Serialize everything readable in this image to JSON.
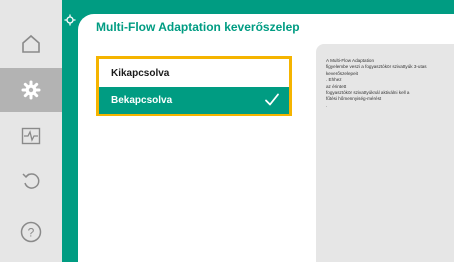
{
  "header": {
    "title": "Multi-Flow Adaptation keverőszelep"
  },
  "rail": {
    "items": [
      {
        "icon": "home-icon",
        "active": false
      },
      {
        "icon": "settings-gear-icon",
        "active": true
      },
      {
        "icon": "diagnostics-icon",
        "active": false
      },
      {
        "icon": "undo-icon",
        "active": false
      },
      {
        "icon": "help-icon",
        "active": false
      }
    ]
  },
  "options": {
    "items": [
      {
        "label": "Kikapcsolva",
        "selected": false
      },
      {
        "label": "Bekapcsolva",
        "selected": true
      }
    ]
  },
  "info": {
    "lines": [
      "A Multi-Flow Adaptation",
      "figyelembe veszi a fogyasztókör szivattyúk 3-utas",
      "keverőszelepeit",
      ". Ehhez",
      "az érintett",
      "fogyasztókör szivattyúknál aktiválni kell a",
      "fűtési hőmennyiség-mérést",
      "."
    ]
  },
  "colors": {
    "accent": "#009c82",
    "focus": "#f5b400",
    "rail_bg": "#e6e6e6",
    "rail_active": "#b3b3b3",
    "info_bg": "#e6e6e6"
  }
}
